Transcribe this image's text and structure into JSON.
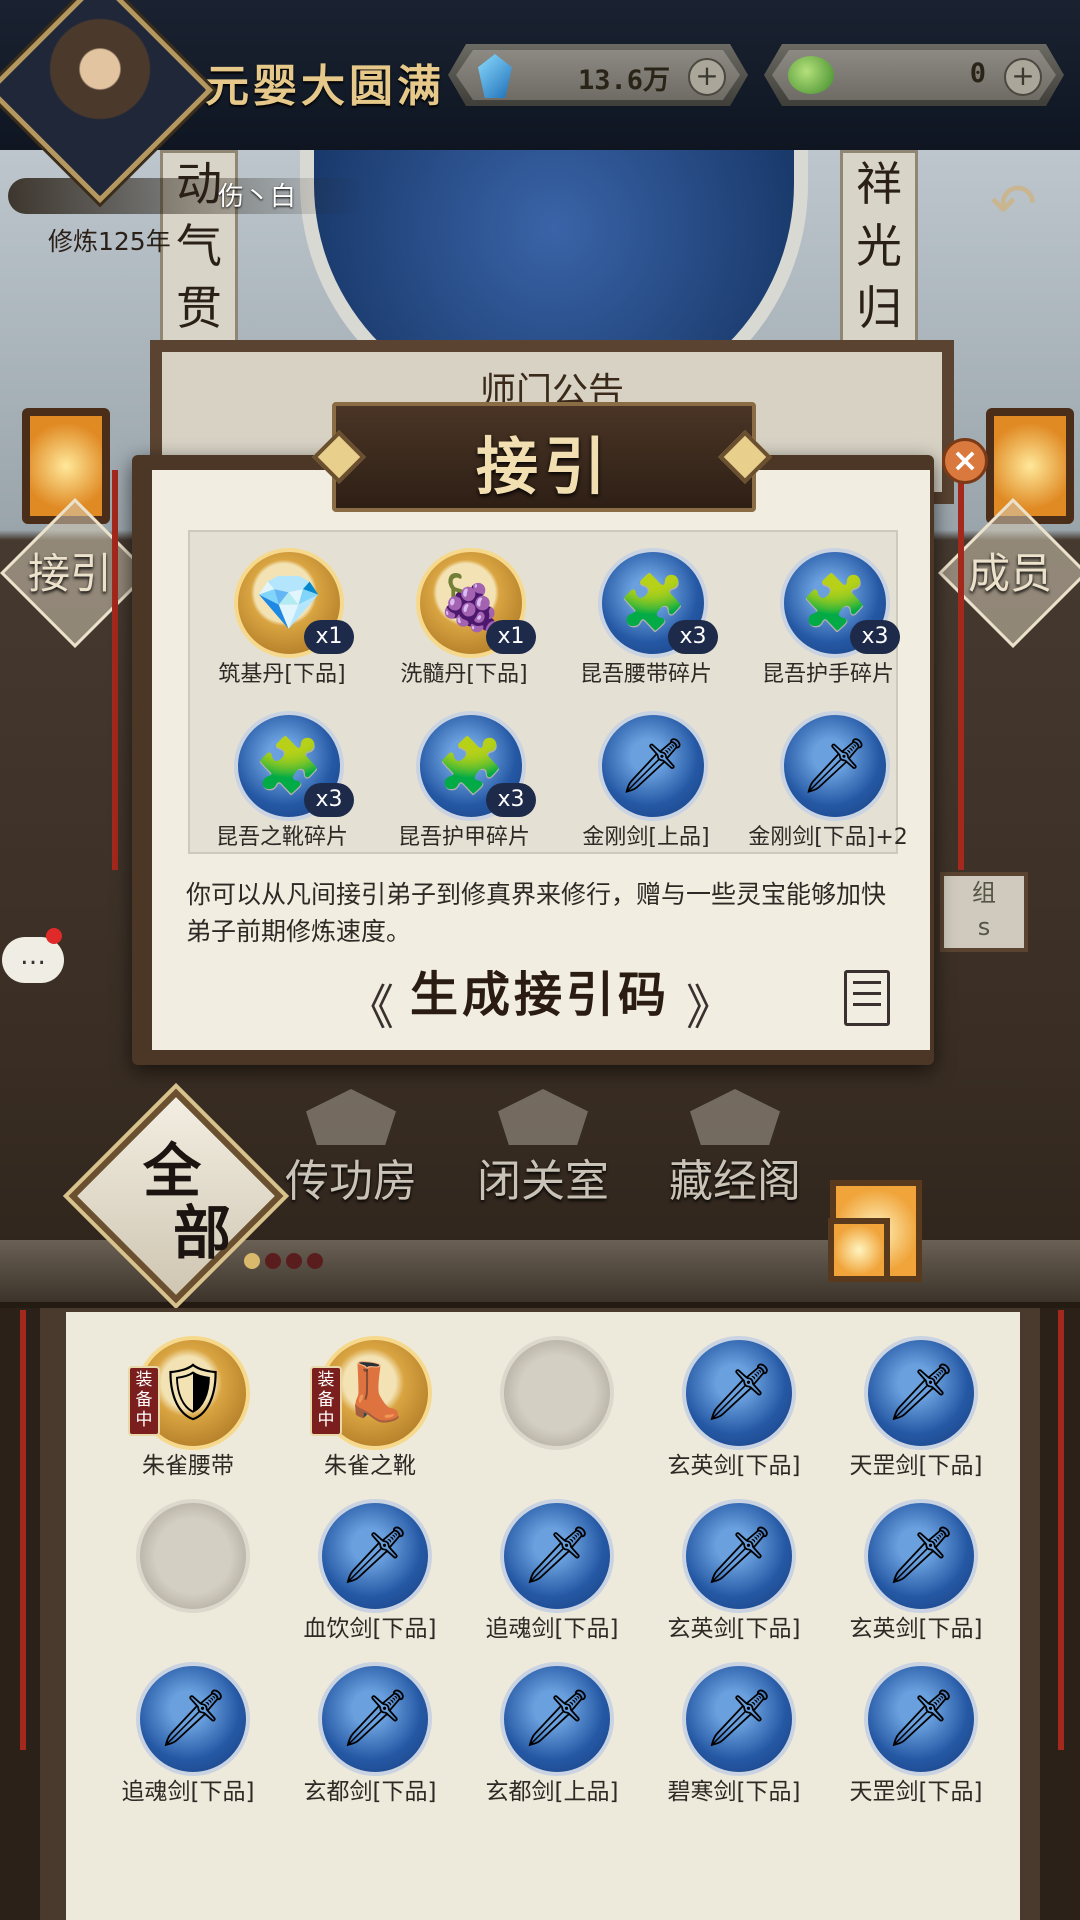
{
  "header": {
    "realm_title": "元婴大圆满",
    "spirit_stones": "13.6万",
    "jade_currency": "0",
    "add_label": "+"
  },
  "player": {
    "name": "伤丶白",
    "cultivation_years": "修炼125年"
  },
  "scene": {
    "left_couplet": "动气贯黄",
    "right_couplet": "祥光归紫",
    "notice_title": "师门公告",
    "left_button": "接引",
    "right_button": "成员",
    "group_plaque": "组\ns",
    "chat_icon": "…",
    "back_icon": "↶"
  },
  "modal": {
    "title": "接引",
    "close_label": "×",
    "rewards": [
      {
        "name": "筑基丹[下品]",
        "count": "x1",
        "style": "gold",
        "glyph": "💎"
      },
      {
        "name": "洗髓丹[下品]",
        "count": "x1",
        "style": "gold",
        "glyph": "🍇"
      },
      {
        "name": "昆吾腰带碎片",
        "count": "x3",
        "style": "blue",
        "glyph": "🧩"
      },
      {
        "name": "昆吾护手碎片",
        "count": "x3",
        "style": "blue",
        "glyph": "🧩"
      },
      {
        "name": "昆吾之靴碎片",
        "count": "x3",
        "style": "blue",
        "glyph": "🧩"
      },
      {
        "name": "昆吾护甲碎片",
        "count": "x3",
        "style": "blue",
        "glyph": "🧩"
      },
      {
        "name": "金刚剑[上品]",
        "count": "",
        "style": "blue",
        "glyph": "🗡"
      },
      {
        "name": "金刚剑[下品]+2",
        "count": "",
        "style": "blue",
        "glyph": "🗡"
      }
    ],
    "description": "你可以从凡间接引弟子到修真界来修行，赠与一些灵宝能够加快弟子前期修炼速度。",
    "generate_button": "生成接引码",
    "arrow_left": "《",
    "arrow_right": "》"
  },
  "tabs": {
    "category": "全部",
    "category_line1": "全",
    "category_line2": "部",
    "buildings": [
      "传功房",
      "闭关室",
      "藏经阁"
    ],
    "page_count": 4,
    "active_page": 0
  },
  "inventory": {
    "equipped_label": "装备中",
    "items": [
      {
        "name": "朱雀腰带",
        "style": "gold",
        "glyph": "🛡",
        "equipped": true
      },
      {
        "name": "朱雀之靴",
        "style": "gold",
        "glyph": "👢",
        "equipped": true
      },
      {
        "name": "",
        "style": "grey",
        "glyph": "",
        "equipped": false
      },
      {
        "name": "玄英剑[下品]",
        "style": "blue",
        "glyph": "🗡",
        "equipped": false
      },
      {
        "name": "天罡剑[下品]",
        "style": "blue",
        "glyph": "🗡",
        "equipped": false
      },
      {
        "name": "",
        "style": "grey",
        "glyph": "",
        "equipped": false
      },
      {
        "name": "血饮剑[下品]",
        "style": "blue",
        "glyph": "🗡",
        "equipped": false
      },
      {
        "name": "追魂剑[下品]",
        "style": "blue",
        "glyph": "🗡",
        "equipped": false
      },
      {
        "name": "玄英剑[下品]",
        "style": "blue",
        "glyph": "🗡",
        "equipped": false
      },
      {
        "name": "玄英剑[下品]",
        "style": "blue",
        "glyph": "🗡",
        "equipped": false
      },
      {
        "name": "追魂剑[下品]",
        "style": "blue",
        "glyph": "🗡",
        "equipped": false
      },
      {
        "name": "玄都剑[下品]",
        "style": "blue",
        "glyph": "🗡",
        "equipped": false
      },
      {
        "name": "玄都剑[上品]",
        "style": "blue",
        "glyph": "🗡",
        "equipped": false
      },
      {
        "name": "碧寒剑[下品]",
        "style": "blue",
        "glyph": "🗡",
        "equipped": false
      },
      {
        "name": "天罡剑[下品]",
        "style": "blue",
        "glyph": "🗡",
        "equipped": false
      }
    ]
  }
}
